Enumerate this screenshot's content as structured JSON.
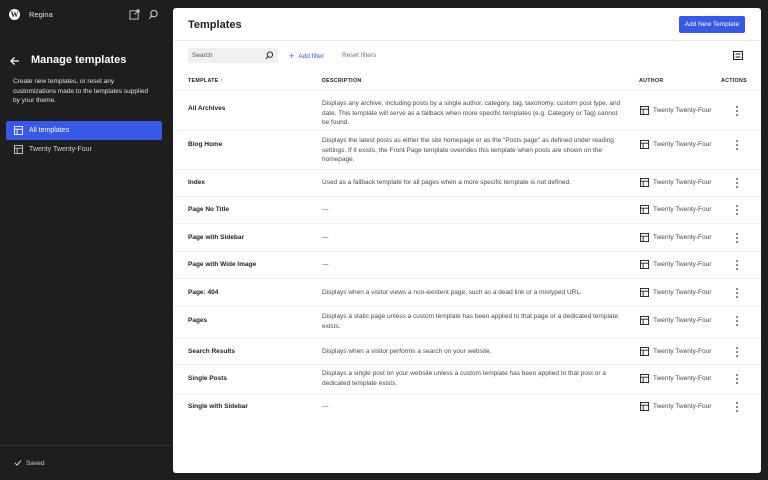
{
  "topbar": {
    "site_name": "Regina",
    "logo_letter": "W",
    "icons": [
      "wordpress-logo-icon",
      "external-view-icon",
      "search-icon"
    ]
  },
  "sidebar": {
    "title": "Manage templates",
    "description": "Create new templates, or reset any customizations made to the templates supplied by your theme.",
    "items": [
      {
        "label": "All templates",
        "icon": "layout-icon",
        "active": true
      },
      {
        "label": "Twenty Twenty-Four",
        "icon": "layout-icon",
        "active": false
      }
    ],
    "saved_label": "Saved"
  },
  "main": {
    "title": "Templates",
    "add_new_label": "Add New Template",
    "search_placeholder": "Search",
    "add_filter_label": "Add filter",
    "reset_filters_label": "Reset filters",
    "columns": {
      "template": "TEMPLATE ↑",
      "description": "DESCRIPTION",
      "author": "AUTHOR",
      "actions": "ACTIONS"
    },
    "rows": [
      {
        "name": "All Archives",
        "description": "Displays any archive, including posts by a single author, category, tag, taxonomy, custom post type, and date. This template will serve as a fallback when more specific templates (e.g. Category or Tag) cannot be found.",
        "author": "Twenty Twenty-Four"
      },
      {
        "name": "Blog Home",
        "description": "Displays the latest posts as either the site homepage or as the \"Posts page\" as defined under reading settings. If it exists, the Front Page template overrides this template when posts are shown on the homepage.",
        "author": "Twenty Twenty-Four"
      },
      {
        "name": "Index",
        "description": "Used as a fallback template for all pages when a more specific template is not defined.",
        "author": "Twenty Twenty-Four"
      },
      {
        "name": "Page No Title",
        "description": "—",
        "author": "Twenty Twenty-Four"
      },
      {
        "name": "Page with Sidebar",
        "description": "—",
        "author": "Twenty Twenty-Four"
      },
      {
        "name": "Page with Wide Image",
        "description": "—",
        "author": "Twenty Twenty-Four"
      },
      {
        "name": "Page: 404",
        "description": "Displays when a visitor views a non-existent page, such as a dead link or a mistyped URL.",
        "author": "Twenty Twenty-Four"
      },
      {
        "name": "Pages",
        "description": "Displays a static page unless a custom template has been applied to that page or a dedicated template exists.",
        "author": "Twenty Twenty-Four"
      },
      {
        "name": "Search Results",
        "description": "Displays when a visitor performs a search on your website.",
        "author": "Twenty Twenty-Four"
      },
      {
        "name": "Single Posts",
        "description": "Displays a single post on your website unless a custom template has been applied to that post or a dedicated template exists.",
        "author": "Twenty Twenty-Four"
      },
      {
        "name": "Single with Sidebar",
        "description": "—",
        "author": "Twenty Twenty-Four"
      }
    ]
  },
  "colors": {
    "accent": "#3858e9",
    "frame": "#1e1e1e"
  }
}
